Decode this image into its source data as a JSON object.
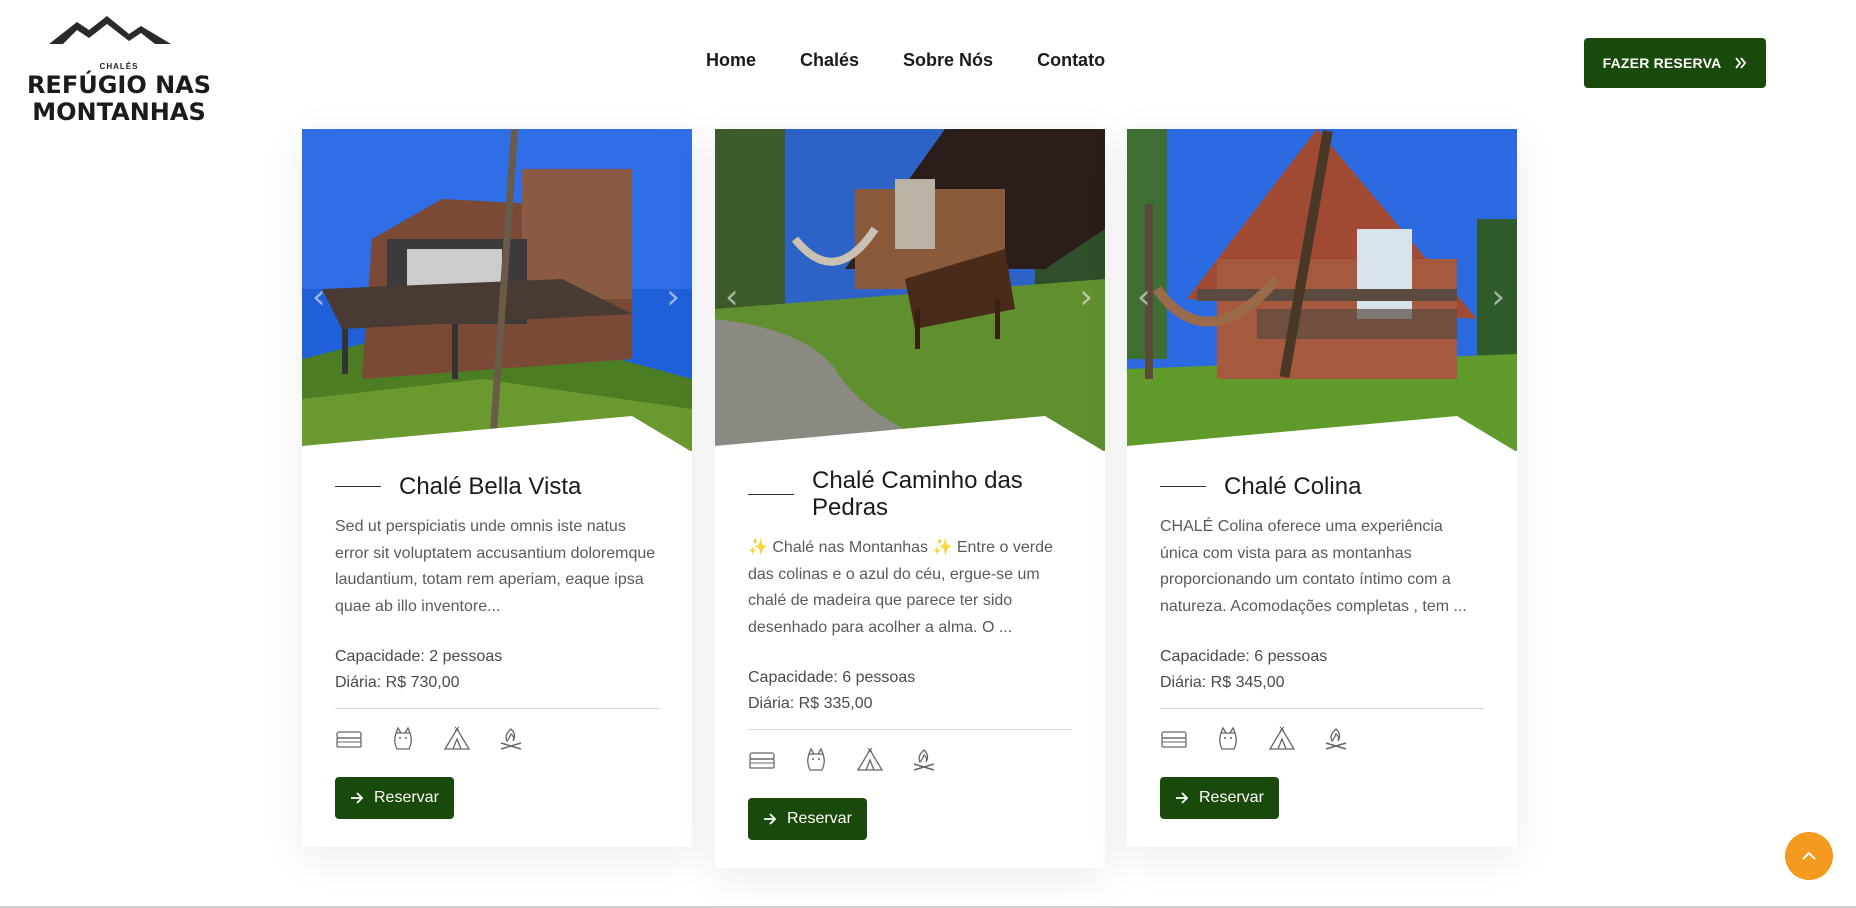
{
  "header": {
    "logo": {
      "small": "CHALÉS",
      "line1": "REFÚGIO NAS",
      "line2": "MONTANHAS"
    },
    "nav": [
      "Home",
      "Chalés",
      "Sobre Nós",
      "Contato"
    ],
    "cta": {
      "label": "FAZER RESERVA",
      "icon": "double-chevron-right-icon"
    }
  },
  "colors": {
    "brand_green": "#1a4a0b",
    "accent_orange": "#f39a1f"
  },
  "cards": [
    {
      "title": "Chalé Bella Vista",
      "description": "Sed ut perspiciatis unde omnis iste natus error sit voluptatem accusantium doloremque laudantium, totam rem aperiam, eaque ipsa quae ab illo inventore...",
      "capacity": "Capacidade: 2 pessoas",
      "price": "Diária: R$ 730,00",
      "button": "Reservar"
    },
    {
      "title": "Chalé Caminho das Pedras",
      "description": "✨ Chalé nas Montanhas ✨ Entre o verde das colinas e o azul do céu, ergue-se um chalé de madeira que parece ter sido desenhado para acolher a alma. O ...",
      "capacity": "Capacidade: 6 pessoas",
      "price": "Diária: R$ 335,00",
      "button": "Reservar"
    },
    {
      "title": "Chalé Colina",
      "description": "CHALÉ Colina oferece uma experiência única com vista para as montanhas proporcionando um contato íntimo com a natureza. Acomodações completas , tem ...",
      "capacity": "Capacidade: 6 pessoas",
      "price": "Diária: R$ 345,00",
      "button": "Reservar"
    }
  ],
  "amenity_icons": [
    "bed-icon",
    "pet-cat-icon",
    "tent-icon",
    "campfire-icon"
  ],
  "carousel": {
    "prev_icon": "chevron-left-icon",
    "next_icon": "chevron-right-icon"
  },
  "scroll_top_icon": "chevron-up-icon"
}
